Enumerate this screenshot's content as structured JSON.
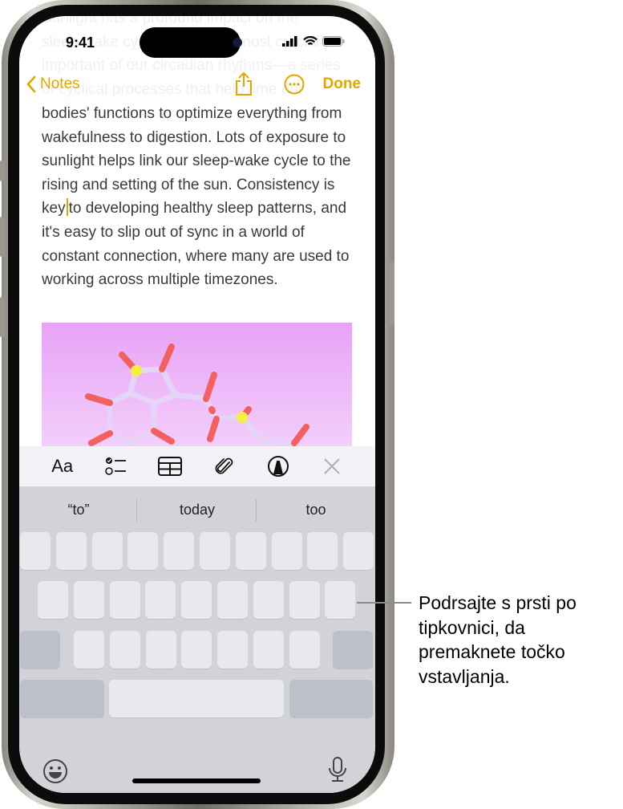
{
  "status_bar": {
    "time": "9:41"
  },
  "nav": {
    "back_label": "Notes",
    "done_label": "Done"
  },
  "note": {
    "scrolled_text_lines": [
      "Sunlight has a profound impact on the",
      "sleep-wake cycle, one of the most crucially",
      "important of our circadian rhythms—a series",
      "of cyclical processes that help time our"
    ],
    "text_before_cursor": "bodies' functions to optimize everything from wakefulness to digestion. Lots of exposure to sunlight helps link our sleep-wake cycle to the rising and setting of the sun. Consistency is key",
    "text_after_cursor": "to developing healthy sleep patterns, and it's easy to slip out of sync in a world of constant connection, where many are used to working across multiple timezones."
  },
  "toolbar": {
    "format_label": "Aa",
    "icons": [
      "format-icon",
      "checklist-icon",
      "table-icon",
      "attachment-icon",
      "markup-icon",
      "close-icon"
    ]
  },
  "keyboard": {
    "suggestions": [
      "“to”",
      "today",
      "too"
    ]
  },
  "callout": {
    "text": "Podrsajte s prsti po tipkovnici, da premaknete točko vstavljanja."
  },
  "colors": {
    "accent": "#e2a600",
    "keyboard_bg": "#d1d3d9",
    "toolbar_bg": "#f2f2f7"
  }
}
